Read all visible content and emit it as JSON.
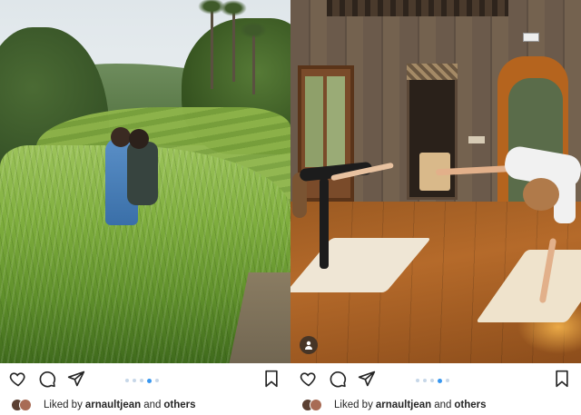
{
  "posts": [
    {
      "photo": {
        "subject": "rice-terrace-photo",
        "show_user_tag": false
      },
      "carousel": {
        "count": 5,
        "active_index": 3
      },
      "liked_by": {
        "prefix": "Liked by",
        "user": "arnaultjean",
        "and": "and",
        "others": "others"
      }
    },
    {
      "photo": {
        "subject": "yoga-room-photo",
        "show_user_tag": true
      },
      "carousel": {
        "count": 5,
        "active_index": 3
      },
      "liked_by": {
        "prefix": "Liked by",
        "user": "arnaultjean",
        "and": "and",
        "others": "others"
      }
    }
  ],
  "icons": {
    "like": "heart-icon",
    "comment": "comment-icon",
    "share": "paper-plane-icon",
    "save": "bookmark-icon",
    "user_tag": "person-icon"
  },
  "colors": {
    "text": "#262626",
    "carousel_active": "#3897f0",
    "carousel_inactive": "#c7d7e8"
  }
}
